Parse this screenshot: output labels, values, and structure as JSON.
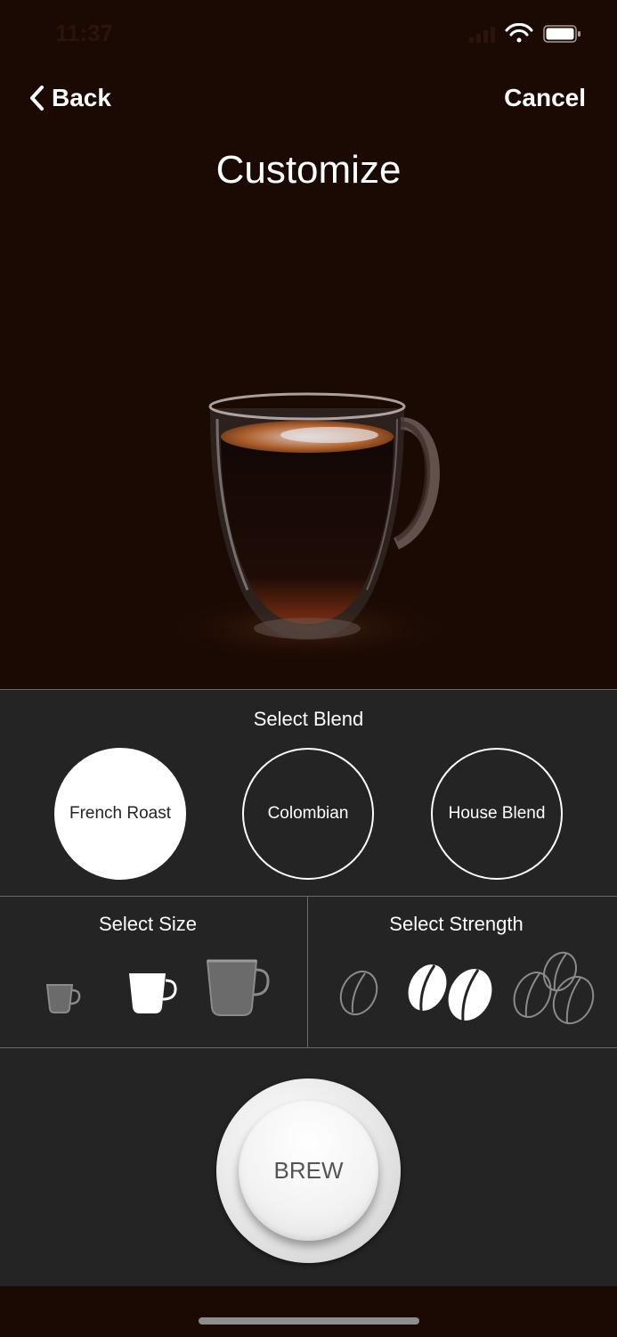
{
  "status_bar": {
    "time": "11:37"
  },
  "nav": {
    "back_label": "Back",
    "cancel_label": "Cancel",
    "title": "Customize"
  },
  "blend": {
    "title": "Select Blend",
    "options": [
      "French Roast",
      "Colombian",
      "House Blend"
    ],
    "selected": "French Roast"
  },
  "size": {
    "title": "Select Size",
    "options": [
      "small-cup-icon",
      "medium-cup-icon",
      "large-cup-icon"
    ],
    "selected_index": 1
  },
  "strength": {
    "title": "Select Strength",
    "options": [
      "one-bean-icon",
      "two-beans-icon",
      "three-beans-icon"
    ],
    "selected_index": 1
  },
  "brew": {
    "label": "BREW"
  },
  "colors": {
    "background": "#1b0904",
    "panel": "#242424",
    "selected": "#ffffff"
  }
}
